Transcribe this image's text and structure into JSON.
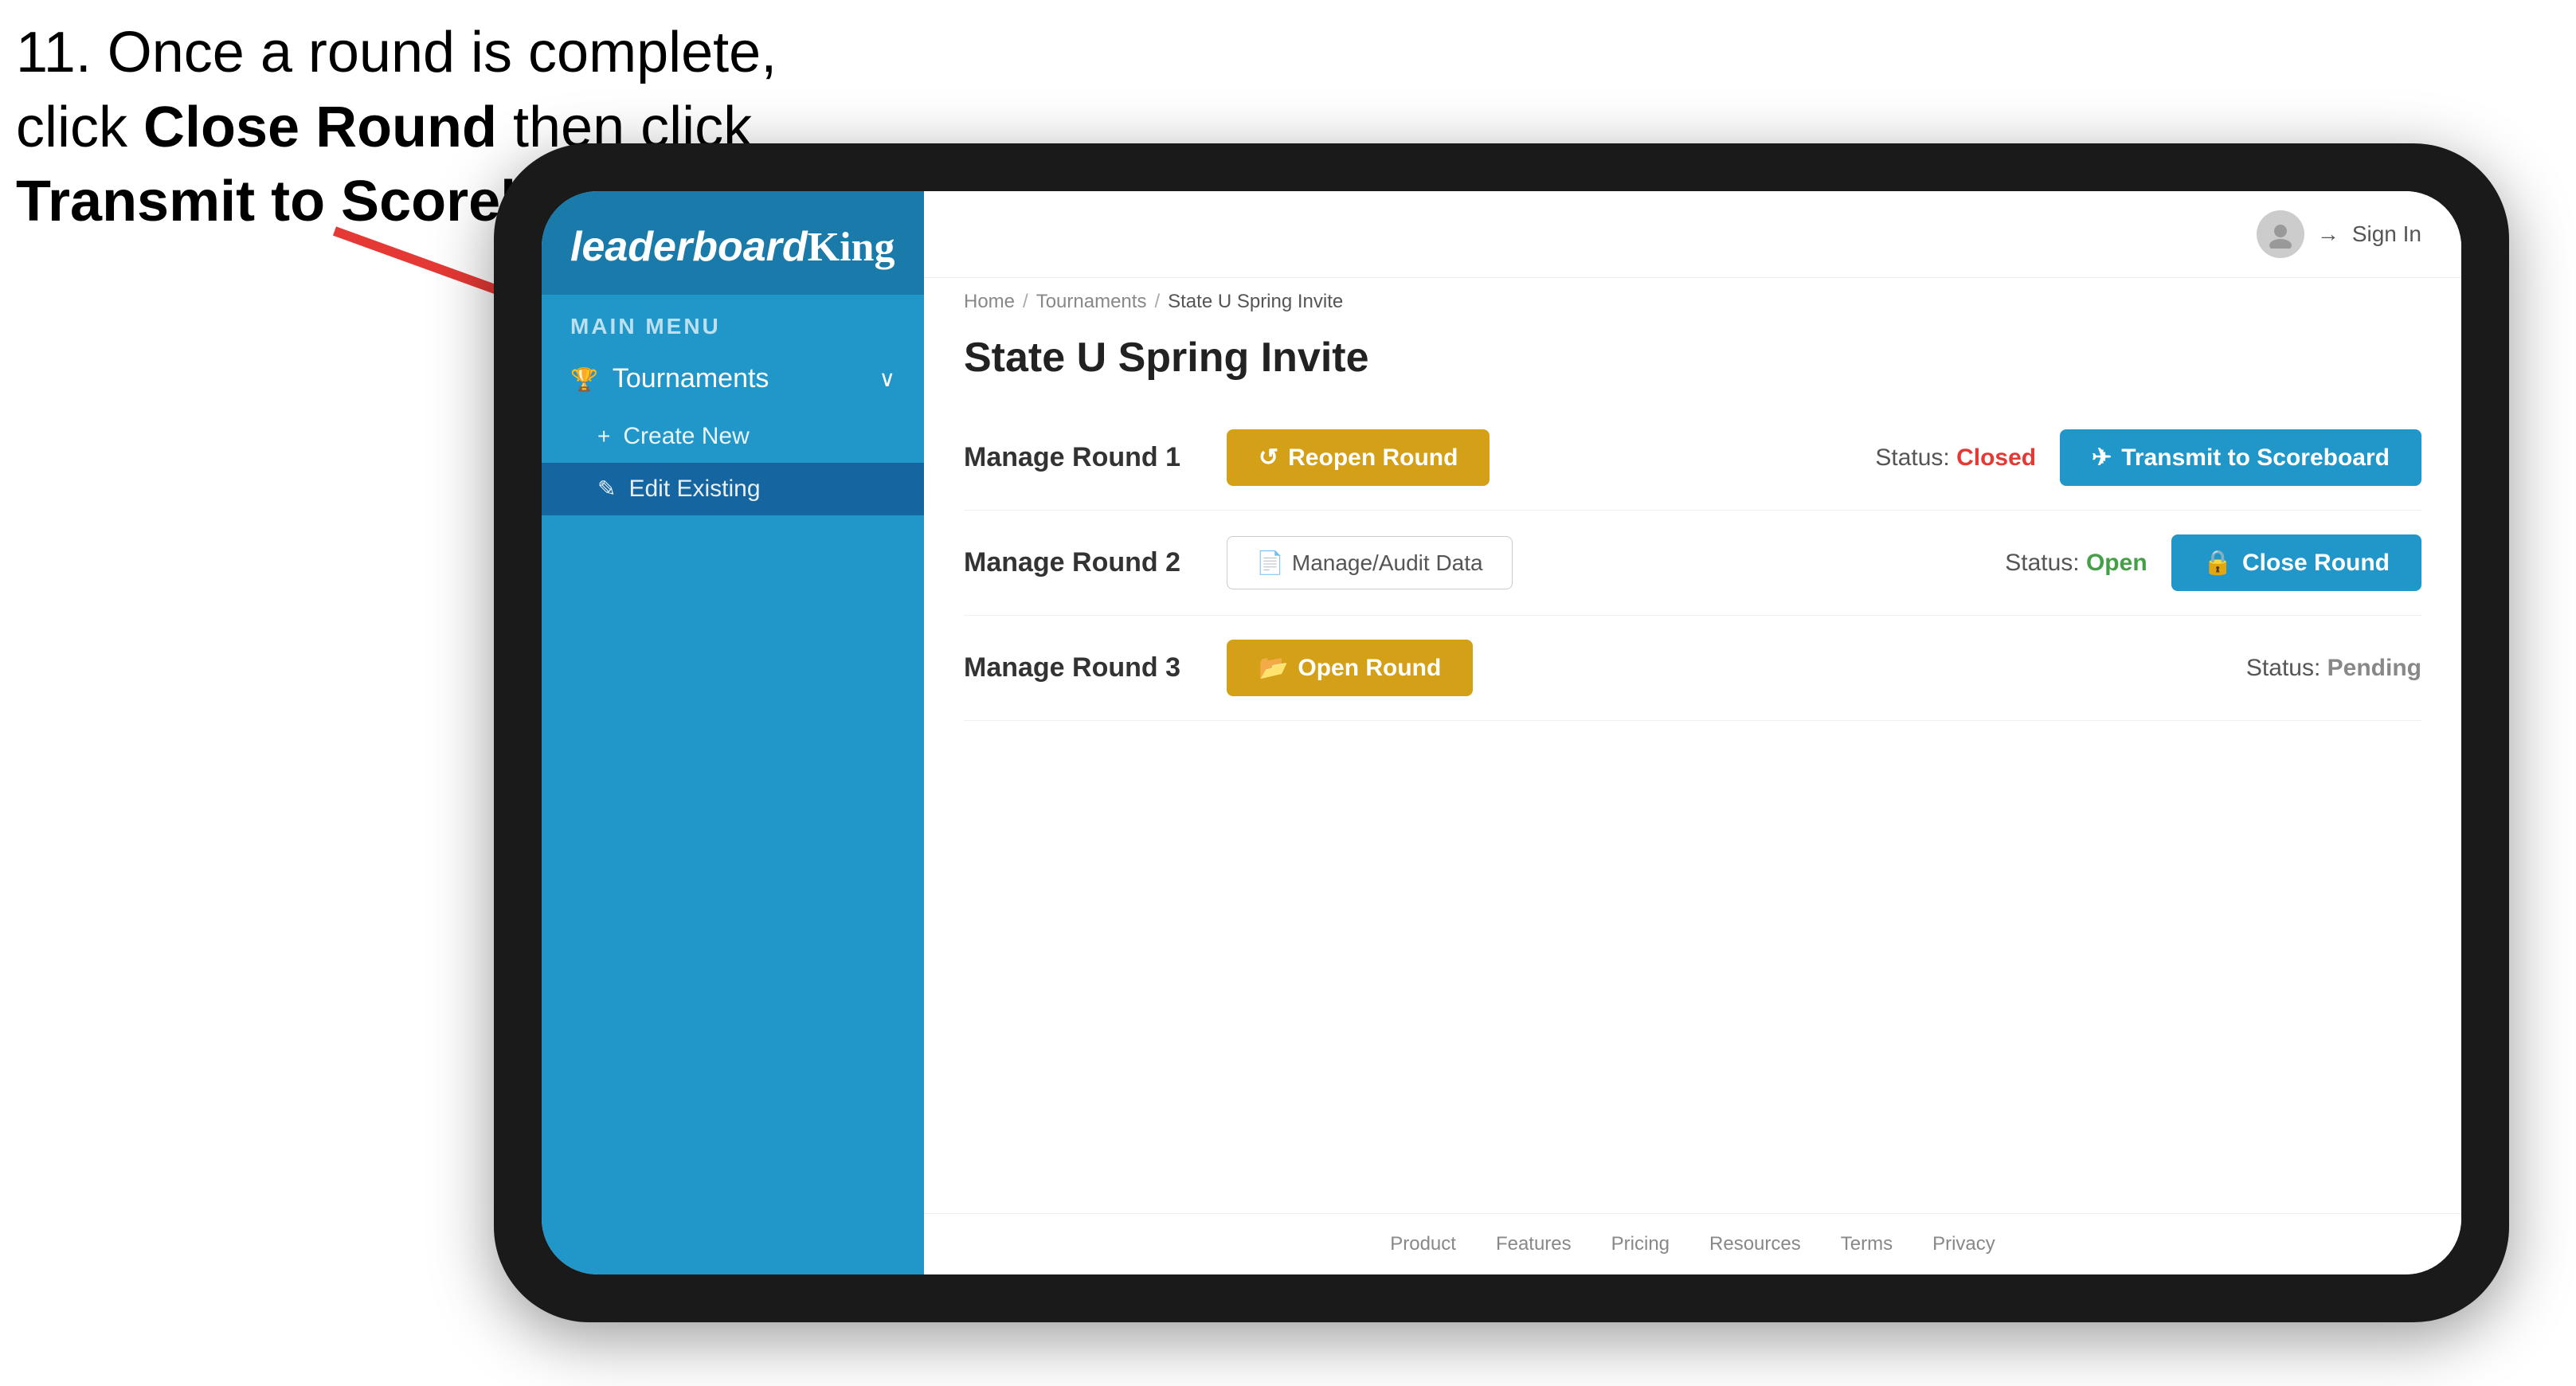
{
  "instruction": {
    "line1": "11. Once a round is complete,",
    "line2_prefix": "click ",
    "line2_bold": "Close Round",
    "line2_suffix": " then click",
    "line3_bold": "Transmit to Scoreboard."
  },
  "sidebar": {
    "main_menu_label": "MAIN MENU",
    "logo": "leaderboardKing",
    "items": [
      {
        "label": "Tournaments",
        "icon": "trophy-icon",
        "expanded": true
      }
    ],
    "subitems": [
      {
        "label": "Create New",
        "icon": "plus-icon"
      },
      {
        "label": "Edit Existing",
        "icon": "edit-icon",
        "selected": true
      }
    ]
  },
  "header": {
    "sign_in_label": "Sign In"
  },
  "breadcrumb": {
    "home": "Home",
    "separator1": "/",
    "tournaments": "Tournaments",
    "separator2": "/",
    "current": "State U Spring Invite"
  },
  "page": {
    "title": "State U Spring Invite",
    "rounds": [
      {
        "id": 1,
        "label": "Manage Round 1",
        "status_label": "Status:",
        "status_value": "Closed",
        "status_class": "status-closed",
        "primary_btn": "Reopen Round",
        "primary_btn_type": "reopen",
        "secondary_btn": "Transmit to Scoreboard",
        "secondary_btn_type": "transmit"
      },
      {
        "id": 2,
        "label": "Manage Round 2",
        "status_label": "Status:",
        "status_value": "Open",
        "status_class": "status-open",
        "primary_btn": "Manage/Audit Data",
        "primary_btn_type": "manage",
        "secondary_btn": "Close Round",
        "secondary_btn_type": "close"
      },
      {
        "id": 3,
        "label": "Manage Round 3",
        "status_label": "Status:",
        "status_value": "Pending",
        "status_class": "status-pending",
        "primary_btn": "Open Round",
        "primary_btn_type": "open",
        "secondary_btn": null,
        "secondary_btn_type": null
      }
    ]
  },
  "footer": {
    "links": [
      "Product",
      "Features",
      "Pricing",
      "Resources",
      "Terms",
      "Privacy"
    ]
  }
}
